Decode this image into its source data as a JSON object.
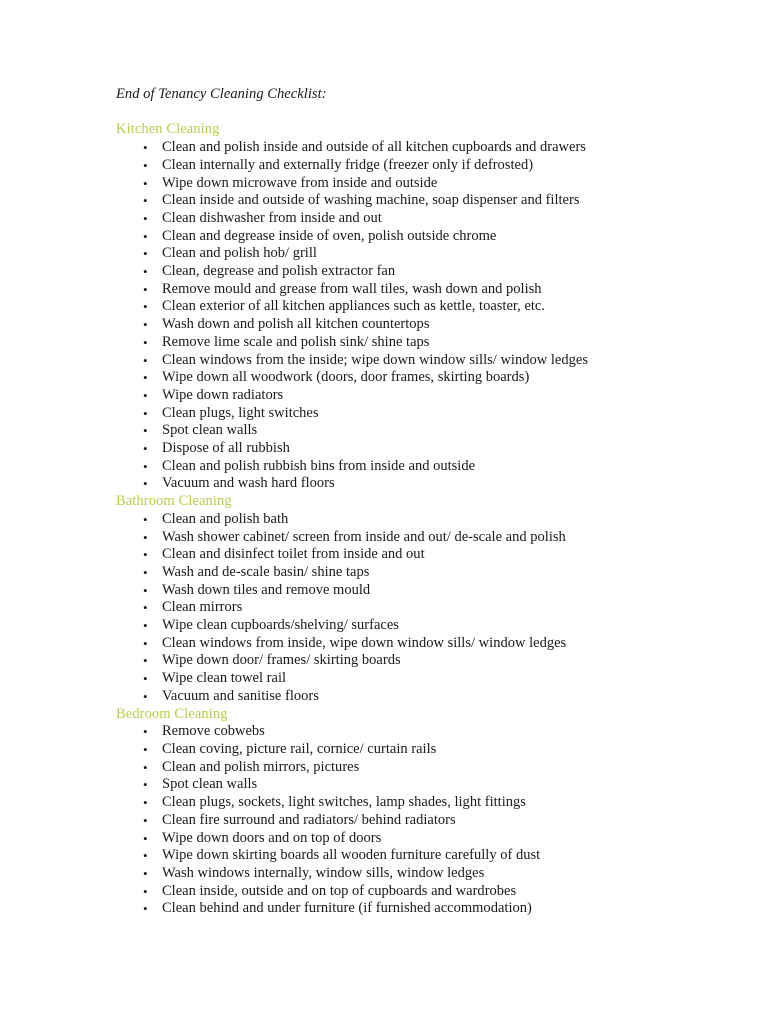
{
  "document": {
    "title": "End of Tenancy Cleaning Checklist:",
    "heading_color": "#b8cc4c",
    "text_color": "#1a1a1a",
    "page_background": "#ffffff",
    "bullet_glyph": "•"
  },
  "sections": [
    {
      "heading": "Kitchen Cleaning",
      "items": [
        "Clean and polish inside and outside of all kitchen cupboards and drawers",
        "Clean internally and externally fridge (freezer only if defrosted)",
        "Wipe down microwave from inside and outside",
        "Clean inside and outside of washing machine, soap dispenser and filters",
        "Clean dishwasher from inside and out",
        "Clean and degrease inside of oven, polish outside chrome",
        "Clean and polish hob/ grill",
        "Clean, degrease and polish extractor fan",
        "Remove mould and grease from wall tiles, wash down and polish",
        "Clean exterior of all kitchen appliances such as kettle, toaster, etc.",
        "Wash down and polish all kitchen countertops",
        "Remove lime scale and polish sink/ shine taps",
        "Clean windows from the inside; wipe down window sills/ window ledges",
        "Wipe down all woodwork (doors, door frames, skirting boards)",
        "Wipe down radiators",
        "Clean plugs, light switches",
        "Spot clean walls",
        "Dispose of all rubbish",
        "Clean and polish rubbish bins from inside and outside",
        "Vacuum and wash hard floors"
      ]
    },
    {
      "heading": "Bathroom Cleaning",
      "items": [
        "Clean and polish bath",
        "Wash shower cabinet/ screen from inside and out/ de-scale and polish",
        "Clean and disinfect toilet from inside and out",
        "Wash and de-scale basin/ shine taps",
        "Wash down tiles and remove mould",
        "Clean mirrors",
        "Wipe clean cupboards/shelving/ surfaces",
        "Clean windows from inside, wipe down window sills/ window ledges",
        "Wipe down door/ frames/ skirting boards",
        "Wipe clean towel rail",
        "Vacuum and sanitise floors"
      ]
    },
    {
      "heading": "Bedroom Cleaning",
      "items": [
        "Remove cobwebs",
        "Clean coving, picture rail, cornice/ curtain rails",
        "Clean and polish mirrors, pictures",
        "Spot clean walls",
        "Clean plugs, sockets, light switches, lamp shades, light fittings",
        "Clean fire surround and radiators/ behind radiators",
        "Wipe down doors and on top of doors",
        "Wipe down skirting boards all wooden furniture carefully of dust",
        "Wash windows internally, window sills, window ledges",
        "Clean inside, outside and on top of cupboards and wardrobes",
        "Clean behind and under furniture (if furnished accommodation)"
      ]
    }
  ]
}
